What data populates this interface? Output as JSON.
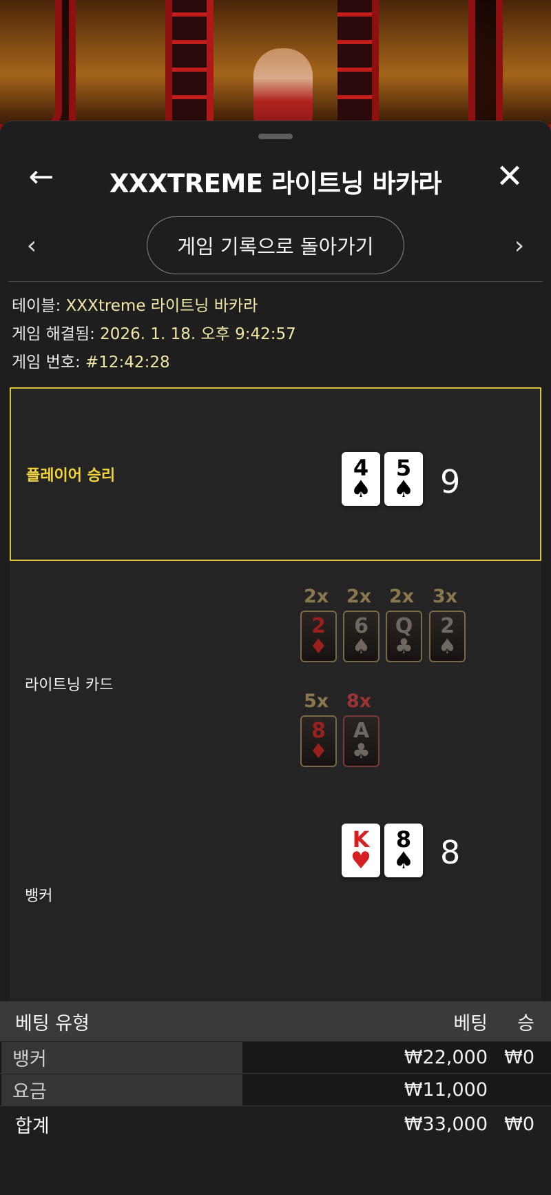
{
  "header": {
    "title": "XXXTREME 라이트닝 바카라",
    "back_icon": "←",
    "close_icon": "✕"
  },
  "nav": {
    "prev_icon": "‹",
    "next_icon": "›",
    "return_label": "게임 기록으로 돌아가기"
  },
  "info": {
    "table_label": "테이블: ",
    "table_value": "XXXtreme 라이트닝 바카라",
    "resolved_label": "게임 해결됨: ",
    "resolved_value": "2026. 1. 18. 오후 9:42:57",
    "number_label": "게임 번호: ",
    "number_value": "#12:42:28"
  },
  "player": {
    "label": "플레이어 승리",
    "cards": [
      {
        "rank": "4",
        "suit": "♠",
        "color": "black"
      },
      {
        "rank": "5",
        "suit": "♠",
        "color": "black"
      }
    ],
    "total": "9"
  },
  "lightning": {
    "label": "라이트닝 카드",
    "cards": [
      {
        "mult": "2x",
        "rank": "2",
        "suit": "♦",
        "color": "red"
      },
      {
        "mult": "2x",
        "rank": "6",
        "suit": "♠",
        "color": "dark"
      },
      {
        "mult": "2x",
        "rank": "Q",
        "suit": "♣",
        "color": "dark"
      },
      {
        "mult": "3x",
        "rank": "2",
        "suit": "♠",
        "color": "dark"
      },
      {
        "mult": "5x",
        "rank": "8",
        "suit": "♦",
        "color": "red"
      },
      {
        "mult": "8x",
        "rank": "A",
        "suit": "♣",
        "color": "dark"
      }
    ]
  },
  "banker": {
    "label": "뱅커",
    "cards": [
      {
        "rank": "K",
        "suit": "♥",
        "color": "red"
      },
      {
        "rank": "8",
        "suit": "♠",
        "color": "black"
      }
    ],
    "total": "8"
  },
  "bets": {
    "headers": {
      "type": "베팅 유형",
      "bet": "베팅",
      "win": "승"
    },
    "rows": [
      {
        "type": "뱅커",
        "bet": "₩22,000",
        "win": "₩0"
      },
      {
        "type": "요금",
        "bet": "₩11,000",
        "win": ""
      }
    ],
    "total": {
      "type": "합계",
      "bet": "₩33,000",
      "win": "₩0"
    }
  }
}
